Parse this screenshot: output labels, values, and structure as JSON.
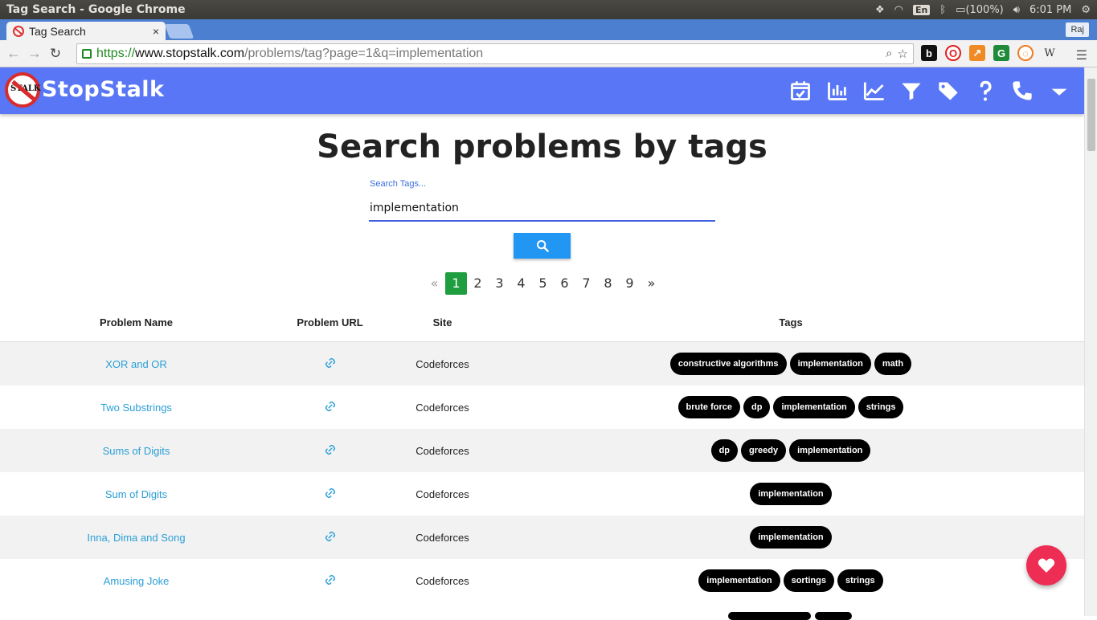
{
  "os": {
    "window_title": "Tag Search - Google Chrome",
    "lang": "En",
    "battery": "(100%)",
    "clock": "6:01 PM"
  },
  "browser": {
    "tab_title": "Tag Search",
    "tab_close": "×",
    "profile": "Raj",
    "url_proto": "https://",
    "url_host": "www.stopstalk.com",
    "url_path": "/problems/tag?page=1&q=implementation"
  },
  "site": {
    "brand": "StopStalk",
    "logo_text": "STALK",
    "nav_icons": [
      "calendar-check-icon",
      "bar-chart-icon",
      "line-chart-icon",
      "filter-icon",
      "tag-icon",
      "help-icon",
      "phone-icon",
      "dropdown-icon"
    ]
  },
  "search": {
    "title": "Search problems by tags",
    "label": "Search Tags...",
    "value": "implementation"
  },
  "pagination": {
    "prev": "«",
    "pages": [
      "1",
      "2",
      "3",
      "4",
      "5",
      "6",
      "7",
      "8",
      "9"
    ],
    "active": "1",
    "next": "»"
  },
  "table": {
    "headers": {
      "name": "Problem Name",
      "url": "Problem URL",
      "site": "Site",
      "tags": "Tags"
    },
    "rows": [
      {
        "name": "XOR and OR",
        "site": "Codeforces",
        "tags": [
          "constructive algorithms",
          "implementation",
          "math"
        ]
      },
      {
        "name": "Two Substrings",
        "site": "Codeforces",
        "tags": [
          "brute force",
          "dp",
          "implementation",
          "strings"
        ]
      },
      {
        "name": "Sums of Digits",
        "site": "Codeforces",
        "tags": [
          "dp",
          "greedy",
          "implementation"
        ]
      },
      {
        "name": "Sum of Digits",
        "site": "Codeforces",
        "tags": [
          "implementation"
        ]
      },
      {
        "name": "Inna, Dima and Song",
        "site": "Codeforces",
        "tags": [
          "implementation"
        ]
      },
      {
        "name": "Amusing Joke",
        "site": "Codeforces",
        "tags": [
          "implementation",
          "sortings",
          "strings"
        ]
      }
    ]
  },
  "colors": {
    "navbar": "#5876f5",
    "link": "#2a9fd6",
    "search_button": "#2196f3",
    "active_page": "#1e9e3e",
    "fab": "#ee2d55"
  }
}
